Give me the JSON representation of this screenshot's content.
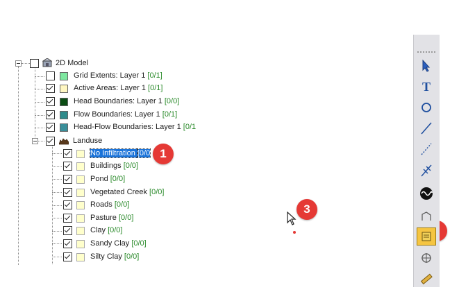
{
  "tree": {
    "root": {
      "label": "2D Model"
    },
    "items": [
      {
        "name": "Grid Extents: Layer 1",
        "count": "[0/1]",
        "color": "#7ee7a0",
        "checked": false
      },
      {
        "name": "Active Areas: Layer 1",
        "count": "[0/1]",
        "color": "#fff7c2",
        "checked": true
      },
      {
        "name": "Head Boundaries: Layer 1",
        "count": "[0/0]",
        "color": "#0b4d14",
        "checked": true
      },
      {
        "name": "Flow Boundaries: Layer 1",
        "count": "[0/1]",
        "color": "#2e8b8b",
        "checked": true
      },
      {
        "name": "Head-Flow Boundaries: Layer 1",
        "count": "[0/1",
        "color": "#3a8f9a",
        "checked": true
      }
    ],
    "landuse": {
      "label": "Landuse",
      "children": [
        {
          "name": "No Infiltration",
          "count": "[0/0",
          "selected": true
        },
        {
          "name": "Buildings",
          "count": "[0/0]"
        },
        {
          "name": "Pond",
          "count": "[0/0]"
        },
        {
          "name": "Vegetated Creek",
          "count": "[0/0]"
        },
        {
          "name": "Roads",
          "count": "[0/0]"
        },
        {
          "name": "Pasture",
          "count": "[0/0]"
        },
        {
          "name": "Clay",
          "count": "[0/0]"
        },
        {
          "name": "Sandy Clay",
          "count": "[0/0]"
        },
        {
          "name": "Silty Clay",
          "count": "[0/0]"
        }
      ],
      "child_swatch_color": "#ffffcc"
    }
  },
  "badges": {
    "one": "1",
    "two": "2",
    "three": "3"
  },
  "toolbar": {
    "tools": [
      {
        "icon": "select-arrow-icon"
      },
      {
        "icon": "text-tool-icon",
        "glyph": "T"
      },
      {
        "icon": "circle-tool-icon"
      },
      {
        "icon": "line-tool-icon"
      },
      {
        "icon": "dashed-line-tool-icon"
      },
      {
        "icon": "arc-node-tool-icon"
      },
      {
        "icon": "wave-tool-icon"
      },
      {
        "icon": "polygon-tool-icon"
      },
      {
        "icon": "landuse-polygon-tool-icon",
        "active": true
      },
      {
        "icon": "crosshair-tool-icon"
      },
      {
        "icon": "ruler-tool-icon"
      }
    ]
  },
  "colors": {
    "selection": "#1a73d9",
    "count_text": "#2a8a2a",
    "badge": "#e53935",
    "active_tool": "#f5c542"
  }
}
